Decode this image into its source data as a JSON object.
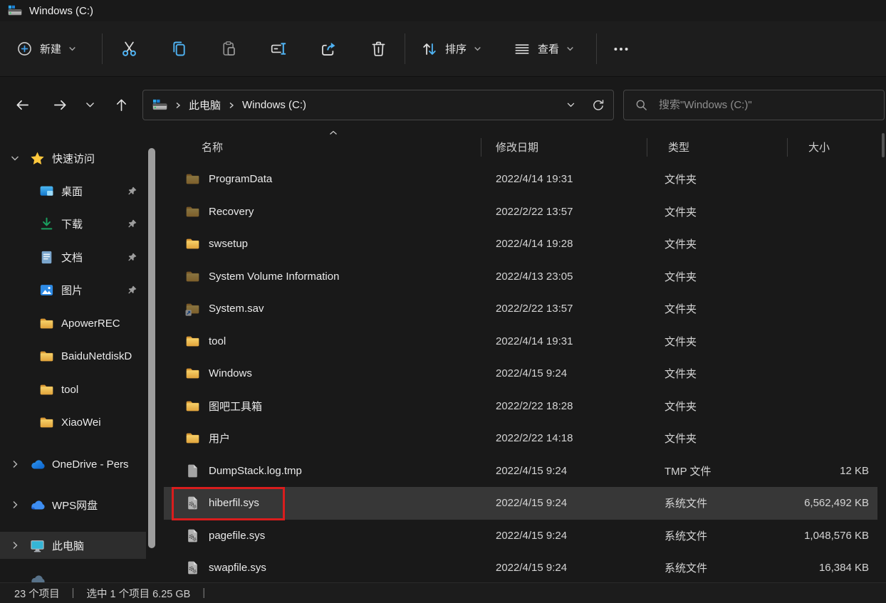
{
  "window": {
    "title": "Windows (C:)"
  },
  "toolbar": {
    "new_label": "新建",
    "sort_label": "排序",
    "view_label": "查看"
  },
  "address": {
    "crumbs": [
      "此电脑",
      "Windows (C:)"
    ],
    "search_placeholder": "搜索\"Windows (C:)\""
  },
  "sidebar": {
    "items": [
      {
        "label": "快速访问",
        "icon": "star",
        "kind": "root",
        "chevron": "down"
      },
      {
        "label": "桌面",
        "icon": "desktop",
        "kind": "child",
        "pinned": true
      },
      {
        "label": "下载",
        "icon": "download",
        "kind": "child",
        "pinned": true
      },
      {
        "label": "文档",
        "icon": "document",
        "kind": "child",
        "pinned": true
      },
      {
        "label": "图片",
        "icon": "picture",
        "kind": "child",
        "pinned": true
      },
      {
        "label": "ApowerREC",
        "icon": "folder",
        "kind": "child"
      },
      {
        "label": "BaiduNetdiskD",
        "icon": "folder",
        "kind": "child"
      },
      {
        "label": "tool",
        "icon": "folder",
        "kind": "child"
      },
      {
        "label": "XiaoWei",
        "icon": "folder",
        "kind": "child"
      },
      {
        "label": "OneDrive - Pers",
        "icon": "onedrive",
        "kind": "root",
        "chevron": "right"
      },
      {
        "label": "WPS网盘",
        "icon": "wps",
        "kind": "root",
        "chevron": "right"
      },
      {
        "label": "此电脑",
        "icon": "thispc",
        "kind": "root",
        "chevron": "right",
        "selected": true
      }
    ]
  },
  "files": {
    "columns": [
      "名称",
      "修改日期",
      "类型",
      "大小"
    ],
    "rows": [
      {
        "name": "ProgramData",
        "icon": "folder",
        "dim": true,
        "date": "2022/4/14 19:31",
        "type": "文件夹",
        "size": ""
      },
      {
        "name": "Recovery",
        "icon": "folder",
        "dim": true,
        "date": "2022/2/22 13:57",
        "type": "文件夹",
        "size": ""
      },
      {
        "name": "swsetup",
        "icon": "folder",
        "dim": false,
        "date": "2022/4/14 19:28",
        "type": "文件夹",
        "size": ""
      },
      {
        "name": "System Volume Information",
        "icon": "folder",
        "dim": true,
        "date": "2022/4/13 23:05",
        "type": "文件夹",
        "size": ""
      },
      {
        "name": "System.sav",
        "icon": "folder-badge",
        "dim": true,
        "date": "2022/2/22 13:57",
        "type": "文件夹",
        "size": ""
      },
      {
        "name": "tool",
        "icon": "folder",
        "dim": false,
        "date": "2022/4/14 19:31",
        "type": "文件夹",
        "size": ""
      },
      {
        "name": "Windows",
        "icon": "folder",
        "dim": false,
        "date": "2022/4/15 9:24",
        "type": "文件夹",
        "size": ""
      },
      {
        "name": "图吧工具箱",
        "icon": "folder",
        "dim": false,
        "date": "2022/2/22 18:28",
        "type": "文件夹",
        "size": ""
      },
      {
        "name": "用户",
        "icon": "folder",
        "dim": false,
        "date": "2022/2/22 14:18",
        "type": "文件夹",
        "size": ""
      },
      {
        "name": "DumpStack.log.tmp",
        "icon": "file",
        "dim": false,
        "date": "2022/4/15 9:24",
        "type": "TMP 文件",
        "size": "12 KB"
      },
      {
        "name": "hiberfil.sys",
        "icon": "sysfile",
        "dim": false,
        "date": "2022/4/15 9:24",
        "type": "系统文件",
        "size": "6,562,492 KB",
        "selected": true,
        "redbox": true
      },
      {
        "name": "pagefile.sys",
        "icon": "sysfile",
        "dim": false,
        "date": "2022/4/15 9:24",
        "type": "系统文件",
        "size": "1,048,576 KB"
      },
      {
        "name": "swapfile.sys",
        "icon": "sysfile",
        "dim": false,
        "date": "2022/4/15 9:24",
        "type": "系统文件",
        "size": "16,384 KB"
      }
    ]
  },
  "status": {
    "count": "23 个项目",
    "selection": "选中 1 个项目  6.25 GB"
  },
  "colors": {
    "accent_blue": "#4fb2f2",
    "red_annotation": "#d91d1d",
    "folder_yellow": "#eebc4e",
    "star_gold": "#ffc83d",
    "selection_bg": "#373737"
  }
}
